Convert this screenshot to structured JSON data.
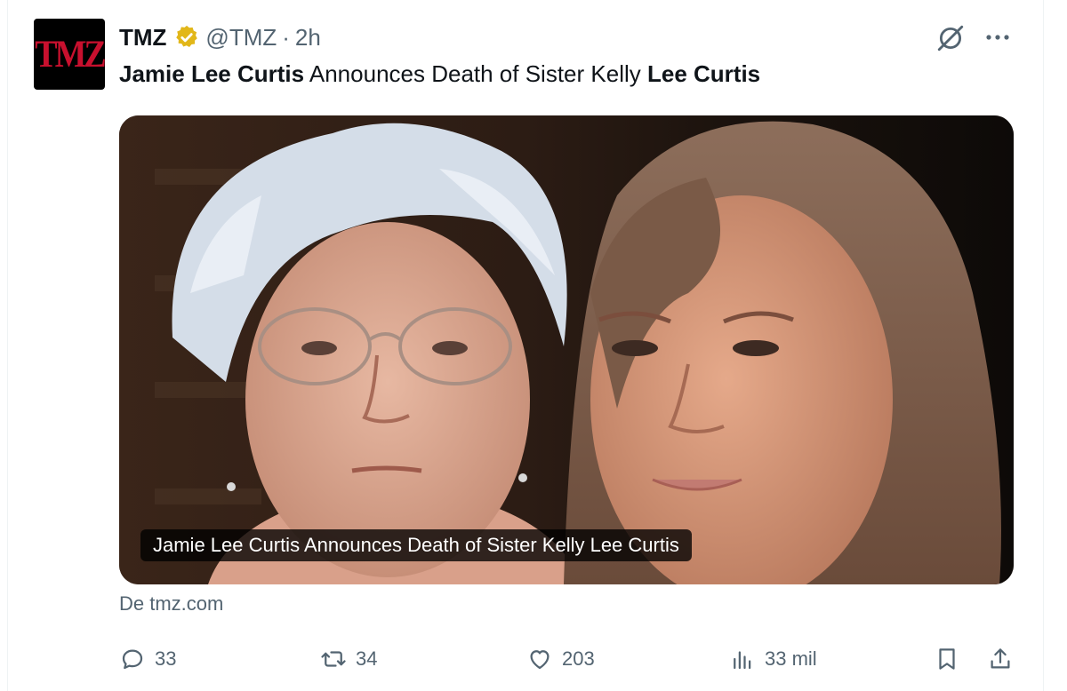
{
  "account": {
    "avatar_text": "TMZ",
    "name": "TMZ",
    "handle": "@TMZ",
    "separator": "·",
    "time": "2h"
  },
  "tweet": {
    "text_parts": [
      {
        "text": "Jamie Lee Curtis",
        "bold": true
      },
      {
        "text": " Announces Death of Sister Kelly ",
        "bold": false
      },
      {
        "text": "Lee Curtis",
        "bold": true
      }
    ]
  },
  "card": {
    "caption": "Jamie Lee Curtis Announces Death of Sister Kelly Lee Curtis",
    "source": "De tmz.com"
  },
  "actions": {
    "replies": "33",
    "reposts": "34",
    "likes": "203",
    "views": "33 mil"
  },
  "icons": {
    "verified": "verified-badge-icon",
    "grok": "grok-icon",
    "more": "more-icon",
    "reply": "reply-icon",
    "repost": "repost-icon",
    "like": "heart-icon",
    "views": "views-icon",
    "bookmark": "bookmark-icon",
    "share": "share-icon"
  },
  "colors": {
    "verified_gold": "#e2b719",
    "text_primary": "#0f1419",
    "text_secondary": "#536471",
    "brand_red": "#c8102e"
  }
}
